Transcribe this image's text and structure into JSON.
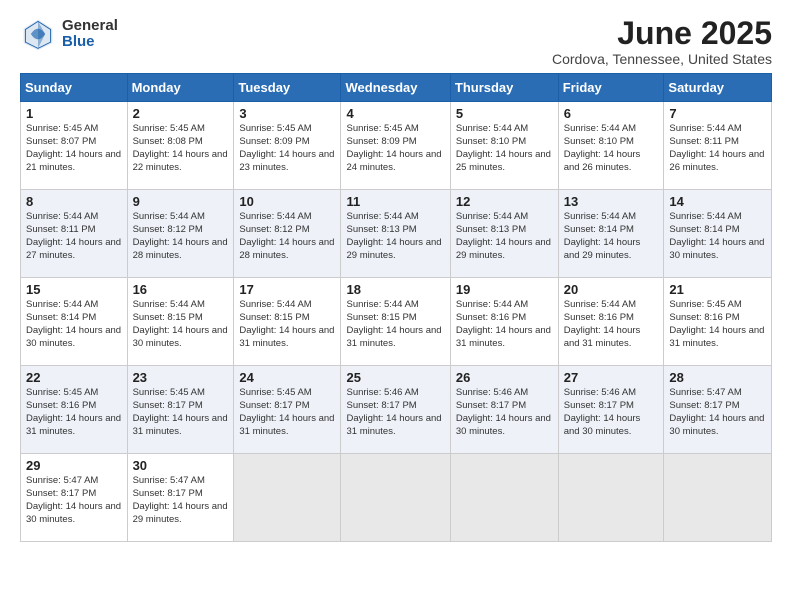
{
  "logo": {
    "general": "General",
    "blue": "Blue"
  },
  "header": {
    "month": "June 2025",
    "location": "Cordova, Tennessee, United States"
  },
  "days": [
    "Sunday",
    "Monday",
    "Tuesday",
    "Wednesday",
    "Thursday",
    "Friday",
    "Saturday"
  ],
  "weeks": [
    [
      {
        "day": "1",
        "sunrise": "5:45 AM",
        "sunset": "8:07 PM",
        "daylight": "14 hours and 21 minutes."
      },
      {
        "day": "2",
        "sunrise": "5:45 AM",
        "sunset": "8:08 PM",
        "daylight": "14 hours and 22 minutes."
      },
      {
        "day": "3",
        "sunrise": "5:45 AM",
        "sunset": "8:09 PM",
        "daylight": "14 hours and 23 minutes."
      },
      {
        "day": "4",
        "sunrise": "5:45 AM",
        "sunset": "8:09 PM",
        "daylight": "14 hours and 24 minutes."
      },
      {
        "day": "5",
        "sunrise": "5:44 AM",
        "sunset": "8:10 PM",
        "daylight": "14 hours and 25 minutes."
      },
      {
        "day": "6",
        "sunrise": "5:44 AM",
        "sunset": "8:10 PM",
        "daylight": "14 hours and 26 minutes."
      },
      {
        "day": "7",
        "sunrise": "5:44 AM",
        "sunset": "8:11 PM",
        "daylight": "14 hours and 26 minutes."
      }
    ],
    [
      {
        "day": "8",
        "sunrise": "5:44 AM",
        "sunset": "8:11 PM",
        "daylight": "14 hours and 27 minutes."
      },
      {
        "day": "9",
        "sunrise": "5:44 AM",
        "sunset": "8:12 PM",
        "daylight": "14 hours and 28 minutes."
      },
      {
        "day": "10",
        "sunrise": "5:44 AM",
        "sunset": "8:12 PM",
        "daylight": "14 hours and 28 minutes."
      },
      {
        "day": "11",
        "sunrise": "5:44 AM",
        "sunset": "8:13 PM",
        "daylight": "14 hours and 29 minutes."
      },
      {
        "day": "12",
        "sunrise": "5:44 AM",
        "sunset": "8:13 PM",
        "daylight": "14 hours and 29 minutes."
      },
      {
        "day": "13",
        "sunrise": "5:44 AM",
        "sunset": "8:14 PM",
        "daylight": "14 hours and 29 minutes."
      },
      {
        "day": "14",
        "sunrise": "5:44 AM",
        "sunset": "8:14 PM",
        "daylight": "14 hours and 30 minutes."
      }
    ],
    [
      {
        "day": "15",
        "sunrise": "5:44 AM",
        "sunset": "8:14 PM",
        "daylight": "14 hours and 30 minutes."
      },
      {
        "day": "16",
        "sunrise": "5:44 AM",
        "sunset": "8:15 PM",
        "daylight": "14 hours and 30 minutes."
      },
      {
        "day": "17",
        "sunrise": "5:44 AM",
        "sunset": "8:15 PM",
        "daylight": "14 hours and 31 minutes."
      },
      {
        "day": "18",
        "sunrise": "5:44 AM",
        "sunset": "8:15 PM",
        "daylight": "14 hours and 31 minutes."
      },
      {
        "day": "19",
        "sunrise": "5:44 AM",
        "sunset": "8:16 PM",
        "daylight": "14 hours and 31 minutes."
      },
      {
        "day": "20",
        "sunrise": "5:44 AM",
        "sunset": "8:16 PM",
        "daylight": "14 hours and 31 minutes."
      },
      {
        "day": "21",
        "sunrise": "5:45 AM",
        "sunset": "8:16 PM",
        "daylight": "14 hours and 31 minutes."
      }
    ],
    [
      {
        "day": "22",
        "sunrise": "5:45 AM",
        "sunset": "8:16 PM",
        "daylight": "14 hours and 31 minutes."
      },
      {
        "day": "23",
        "sunrise": "5:45 AM",
        "sunset": "8:17 PM",
        "daylight": "14 hours and 31 minutes."
      },
      {
        "day": "24",
        "sunrise": "5:45 AM",
        "sunset": "8:17 PM",
        "daylight": "14 hours and 31 minutes."
      },
      {
        "day": "25",
        "sunrise": "5:46 AM",
        "sunset": "8:17 PM",
        "daylight": "14 hours and 31 minutes."
      },
      {
        "day": "26",
        "sunrise": "5:46 AM",
        "sunset": "8:17 PM",
        "daylight": "14 hours and 30 minutes."
      },
      {
        "day": "27",
        "sunrise": "5:46 AM",
        "sunset": "8:17 PM",
        "daylight": "14 hours and 30 minutes."
      },
      {
        "day": "28",
        "sunrise": "5:47 AM",
        "sunset": "8:17 PM",
        "daylight": "14 hours and 30 minutes."
      }
    ],
    [
      {
        "day": "29",
        "sunrise": "5:47 AM",
        "sunset": "8:17 PM",
        "daylight": "14 hours and 30 minutes."
      },
      {
        "day": "30",
        "sunrise": "5:47 AM",
        "sunset": "8:17 PM",
        "daylight": "14 hours and 29 minutes."
      },
      null,
      null,
      null,
      null,
      null
    ]
  ],
  "labels": {
    "sunrise": "Sunrise:",
    "sunset": "Sunset:",
    "daylight": "Daylight:"
  }
}
